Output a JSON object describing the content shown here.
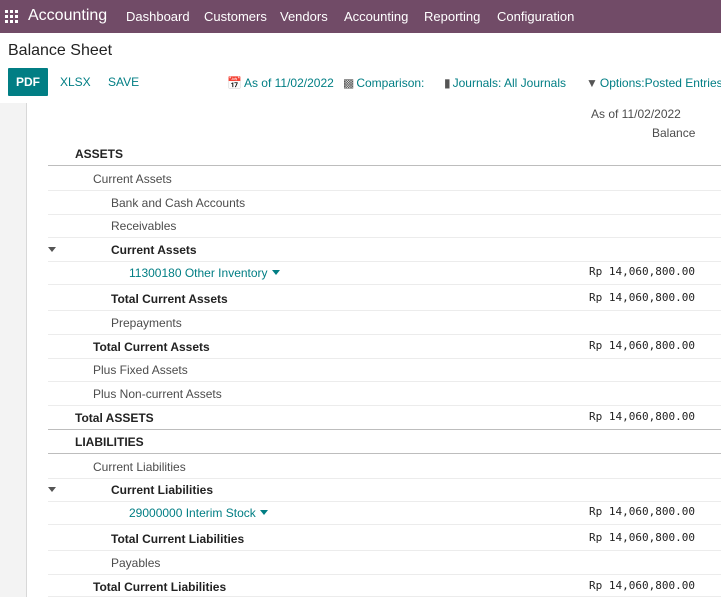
{
  "navbar": {
    "app_title": "Accounting",
    "menu": [
      "Dashboard",
      "Customers",
      "Vendors",
      "Accounting",
      "Reporting",
      "Configuration"
    ]
  },
  "page": {
    "title": "Balance Sheet"
  },
  "toolbar": {
    "pdf": "PDF",
    "xlsx": "XLSX",
    "save": "SAVE"
  },
  "filters": {
    "date": "As of 11/02/2022",
    "comparison": "Comparison:",
    "journals": "Journals: All Journals",
    "options": "Options:Posted Entries"
  },
  "report": {
    "column_date": "As of 11/02/2022",
    "column_balance": "Balance",
    "rows": [
      {
        "label": "ASSETS",
        "amount": ""
      },
      {
        "label": "Current Assets",
        "amount": ""
      },
      {
        "label": "Bank and Cash Accounts",
        "amount": ""
      },
      {
        "label": "Receivables",
        "amount": ""
      },
      {
        "label": "Current Assets",
        "amount": ""
      },
      {
        "label": "11300180 Other Inventory",
        "amount": "Rp 14,060,800.00"
      },
      {
        "label": "Total Current Assets",
        "amount": "Rp 14,060,800.00"
      },
      {
        "label": "Prepayments",
        "amount": ""
      },
      {
        "label": "Total Current Assets",
        "amount": "Rp 14,060,800.00"
      },
      {
        "label": "Plus Fixed Assets",
        "amount": ""
      },
      {
        "label": "Plus Non-current Assets",
        "amount": ""
      },
      {
        "label": "Total ASSETS",
        "amount": "Rp 14,060,800.00"
      },
      {
        "label": "LIABILITIES",
        "amount": ""
      },
      {
        "label": "Current Liabilities",
        "amount": ""
      },
      {
        "label": "Current Liabilities",
        "amount": ""
      },
      {
        "label": "29000000 Interim Stock",
        "amount": "Rp 14,060,800.00"
      },
      {
        "label": "Total Current Liabilities",
        "amount": "Rp 14,060,800.00"
      },
      {
        "label": "Payables",
        "amount": ""
      },
      {
        "label": "Total Current Liabilities",
        "amount": "Rp 14,060,800.00"
      }
    ]
  },
  "colors": {
    "brand": "#714b67",
    "accent": "#017e84"
  }
}
